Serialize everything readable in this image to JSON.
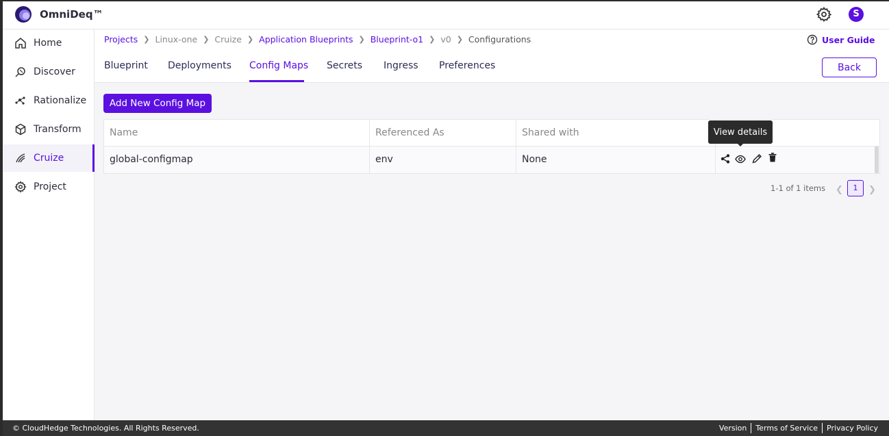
{
  "app": {
    "brand": "OmniDeq™",
    "avatar_initial": "S"
  },
  "sidebar": {
    "items": [
      {
        "label": "Home",
        "icon": "home-icon"
      },
      {
        "label": "Discover",
        "icon": "discover-icon"
      },
      {
        "label": "Rationalize",
        "icon": "rationalize-icon"
      },
      {
        "label": "Transform",
        "icon": "transform-icon"
      },
      {
        "label": "Cruize",
        "icon": "cruize-icon",
        "active": true
      },
      {
        "label": "Project",
        "icon": "project-gear-icon"
      }
    ]
  },
  "breadcrumb": [
    "Projects",
    "Linux-one",
    "Cruize",
    "Application Blueprints",
    "Blueprint-o1",
    "v0",
    "Configurations"
  ],
  "user_guide": "User Guide",
  "tabs": [
    "Blueprint",
    "Deployments",
    "Config Maps",
    "Secrets",
    "Ingress",
    "Preferences"
  ],
  "active_tab": "Config Maps",
  "back_label": "Back",
  "add_button": "Add New Config Map",
  "table": {
    "columns": [
      "Name",
      "Referenced As",
      "Shared with"
    ],
    "rows": [
      {
        "name": "global-configmap",
        "referenced_as": "env",
        "shared_with": "None"
      }
    ]
  },
  "tooltip": "View details",
  "pagination": {
    "info": "1-1 of 1 items",
    "page": "1"
  },
  "footer": {
    "copyright": "© CloudHedge Technologies. All Rights Reserved.",
    "links": [
      "Version",
      "Terms of Service",
      "Privacy Policy"
    ]
  },
  "colors": {
    "accent": "#5b10e0",
    "footer_bg": "#333333"
  }
}
